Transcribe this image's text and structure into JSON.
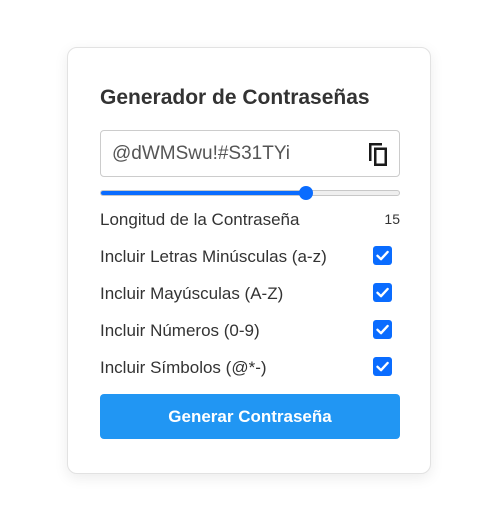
{
  "title": "Generador de Contraseñas",
  "password": {
    "value": "@dWMSwu!#S31TYi",
    "copy_icon": "copy-icon"
  },
  "length": {
    "label": "Longitud de la Contraseña",
    "value": "15",
    "min": 4,
    "max": 20,
    "current": 15
  },
  "options": [
    {
      "label": "Incluir Letras Minúsculas (a-z)",
      "checked": true
    },
    {
      "label": "Incluir Mayúsculas (A-Z)",
      "checked": true
    },
    {
      "label": "Incluir Números (0-9)",
      "checked": true
    },
    {
      "label": "Incluir Símbolos (@*-)",
      "checked": true
    }
  ],
  "generate_label": "Generar Contraseña",
  "colors": {
    "accent": "#0a6cff",
    "button": "#2196f3",
    "text": "#333333"
  }
}
